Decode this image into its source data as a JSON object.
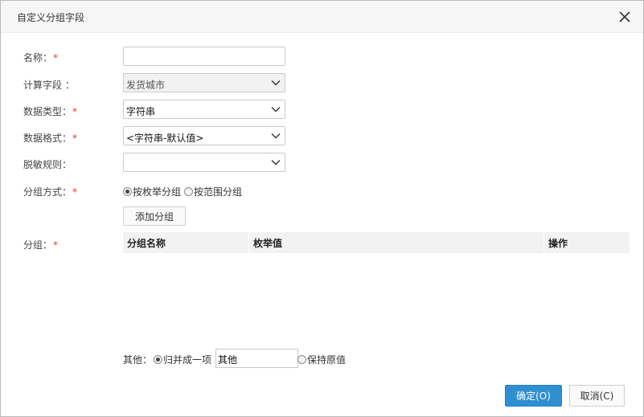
{
  "dialog": {
    "title": "自定义分组字段",
    "close_icon": "close-icon"
  },
  "form": {
    "name": {
      "label": "名称：",
      "required": "*",
      "value": ""
    },
    "calc_field": {
      "label": "计算字段 ：",
      "value": "发货城市"
    },
    "data_type": {
      "label": "数据类型：",
      "required": "*",
      "value": "字符串"
    },
    "data_format": {
      "label": "数据格式：",
      "required": "*",
      "value": "<字符串-默认值>"
    },
    "masking_rule": {
      "label": "脱敏规则：",
      "value": ""
    },
    "group_mode": {
      "label": "分组方式：",
      "required": "*",
      "options": [
        "按枚举分组",
        "按范围分组"
      ],
      "selected": "按枚举分组"
    },
    "add_group_label": "添加分组",
    "groups": {
      "label": "分组：",
      "required": "*",
      "columns": [
        "分组名称",
        "枚举值",
        "操作"
      ],
      "rows": []
    },
    "other": {
      "label": "其他：",
      "options": [
        "归并成一项",
        "保持原值"
      ],
      "selected": "归并成一项",
      "merge_value": "其他"
    }
  },
  "footer": {
    "ok_label": "确定(O)",
    "cancel_label": "取消(C)"
  },
  "colors": {
    "primary": "#2f8fd0",
    "required": "#e53935"
  }
}
